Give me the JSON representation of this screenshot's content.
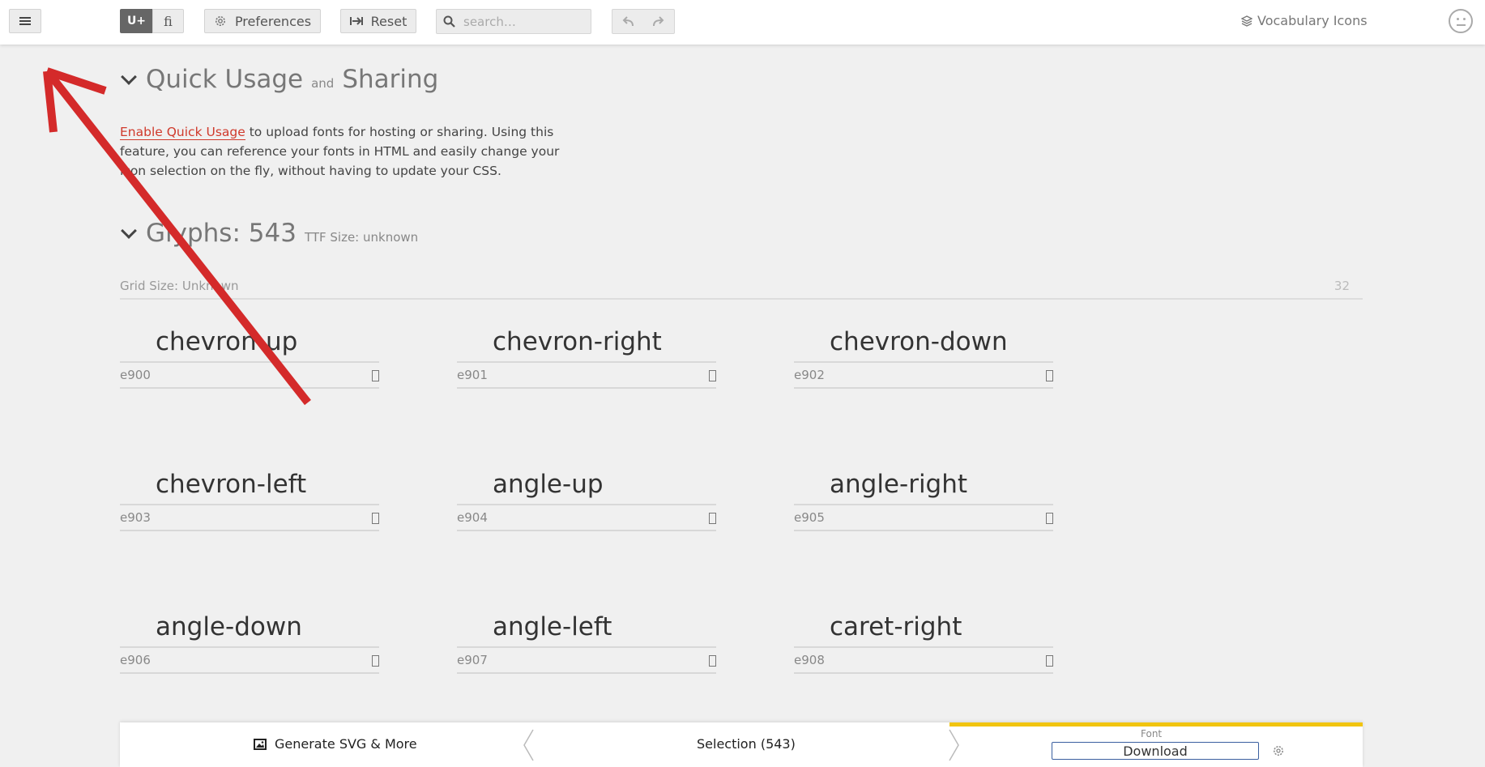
{
  "topbar": {
    "menu_icon": "hamburger-icon",
    "unicode_toggle": "U+",
    "ligature_toggle": "ﬁ",
    "preferences_label": "Preferences",
    "reset_label": "Reset",
    "search_placeholder": "search…",
    "project_name": "Vocabulary Icons"
  },
  "quick_usage": {
    "title_a": "Quick Usage",
    "title_and": "and",
    "title_b": "Sharing",
    "link_text": "Enable Quick Usage",
    "body_text": " to upload fonts for hosting or sharing. Using this feature, you can reference your fonts in HTML and easily change your icon selection on the fly, without having to update your CSS."
  },
  "glyphs": {
    "title": "Glyphs: 543",
    "ttf_size": "TTF Size: unknown",
    "grid_size_label": "Grid Size: Unknown",
    "grid_size_value": "32",
    "items": [
      {
        "name": "chevron-up",
        "code": "e900"
      },
      {
        "name": "chevron-right",
        "code": "e901"
      },
      {
        "name": "chevron-down",
        "code": "e902"
      },
      {
        "name": "chevron-left",
        "code": "e903"
      },
      {
        "name": "angle-up",
        "code": "e904"
      },
      {
        "name": "angle-right",
        "code": "e905"
      },
      {
        "name": "angle-down",
        "code": "e906"
      },
      {
        "name": "angle-left",
        "code": "e907"
      },
      {
        "name": "caret-right",
        "code": "e908"
      }
    ]
  },
  "bottombar": {
    "generate_label": "Generate SVG & More",
    "selection_label": "Selection (543)",
    "font_label": "Font",
    "download_label": "Download"
  },
  "colors": {
    "accent_red": "#d03a2c",
    "font_tab_yellow": "#f1c40f",
    "annotation_arrow": "#d42a2a"
  }
}
